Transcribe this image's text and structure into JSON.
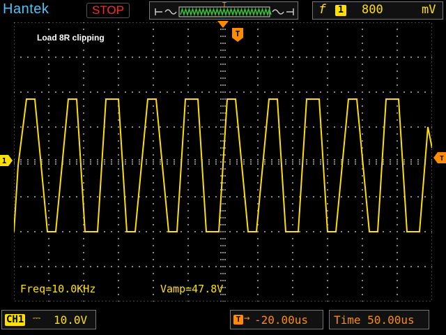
{
  "header": {
    "brand": "Hantek",
    "run_status": "STOP",
    "trigger": {
      "edge_symbol": "f",
      "source": "1",
      "level": "800",
      "unit": "mV"
    }
  },
  "screen": {
    "trace_label": "Load 8R clipping",
    "channel_marker": "1",
    "trigger_marker": "T"
  },
  "measurements": {
    "frequency": "Freq=10.0KHz",
    "amplitude": "Vamp=47.8V"
  },
  "footer": {
    "channel": {
      "name": "CH1",
      "coupling_icon": "dc-coupling-icon",
      "coupling_symbol": "⎓",
      "scale": "10.0V"
    },
    "trigger_position": {
      "icon": "T",
      "arrow": "→",
      "value": "-20.00us"
    },
    "timebase": "Time 50.00us"
  },
  "colors": {
    "trace": "#ffe000",
    "brand": "#4fc3f7",
    "stop": "#ff2a2a",
    "trigger": "#ff8c00",
    "grid": "#8a8a8a"
  },
  "chart_data": {
    "type": "line",
    "title": "Load 8R clipping",
    "xlabel": "",
    "ylabel": "",
    "x_units": "us",
    "y_units": "V",
    "xlim": [
      -270,
      230
    ],
    "ylim": [
      -40,
      40
    ],
    "series": [
      {
        "name": "",
        "x": [
          -270,
          -265,
          -255,
          -245,
          -230,
          -220,
          -205,
          -195,
          -185,
          -170,
          -160,
          -145,
          -135,
          -125,
          -110,
          -100,
          -85,
          -75,
          -65,
          -50,
          -40,
          -25,
          -15,
          -5,
          10,
          20,
          35,
          45,
          55,
          70,
          80,
          95,
          105,
          115,
          130,
          140,
          155,
          165,
          175,
          190,
          200,
          215,
          225,
          230
        ],
        "y": [
          -20,
          -1,
          18,
          18,
          -20,
          -20,
          18,
          18,
          -20,
          -20,
          18,
          18,
          -20,
          -20,
          18,
          18,
          -20,
          -20,
          18,
          18,
          -20,
          -20,
          18,
          18,
          -20,
          -20,
          18,
          18,
          -20,
          -20,
          18,
          18,
          -20,
          -20,
          18,
          18,
          -20,
          -20,
          18,
          18,
          -20,
          -20,
          10,
          4
        ]
      }
    ]
  }
}
